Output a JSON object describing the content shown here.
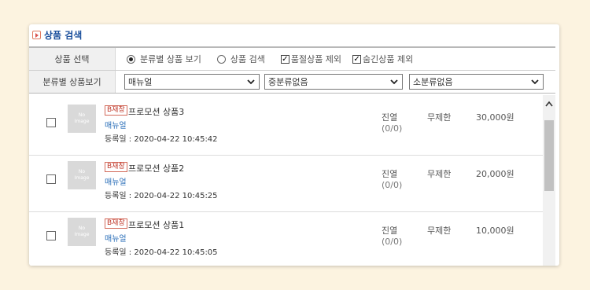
{
  "header": {
    "title": "상품 검색",
    "title_icon": "play-square-icon"
  },
  "filter": {
    "row1_label": "상품 선택",
    "radio_by_category": "분류별 상품 보기",
    "radio_search": "상품 검색",
    "checkbox_exclude_soldout": "품절상품 제외",
    "checkbox_exclude_hidden": "숨긴상품 제외",
    "row2_label": "분류별 상품보기",
    "select_main": "매뉴얼",
    "select_mid": "중분류없음",
    "select_sub": "소분류없음"
  },
  "products": [
    {
      "thumb_line1": "No",
      "thumb_line2": "Image",
      "badge": "B재창",
      "name": "프로모션 상품3",
      "category": "매뉴얼",
      "date": "등록일 : 2020-04-22 10:45:42",
      "display": "진열",
      "stock": "(0/0)",
      "qty": "무제한",
      "price": "30,000원"
    },
    {
      "thumb_line1": "No",
      "thumb_line2": "Image",
      "badge": "B재창",
      "name": "프로모션 상품2",
      "category": "매뉴얼",
      "date": "등록일 : 2020-04-22 10:45:25",
      "display": "진열",
      "stock": "(0/0)",
      "qty": "무제한",
      "price": "20,000원"
    },
    {
      "thumb_line1": "No",
      "thumb_line2": "Image",
      "badge": "B재창",
      "name": "프로모션 상품1",
      "category": "매뉴얼",
      "date": "등록일 : 2020-04-22 10:45:05",
      "display": "진열",
      "stock": "(0/0)",
      "qty": "무제한",
      "price": "10,000원"
    }
  ],
  "colors": {
    "background": "#fcf3e0",
    "title": "#1a4f9c",
    "category_link": "#2a6eb8",
    "badge": "#c0392b"
  }
}
